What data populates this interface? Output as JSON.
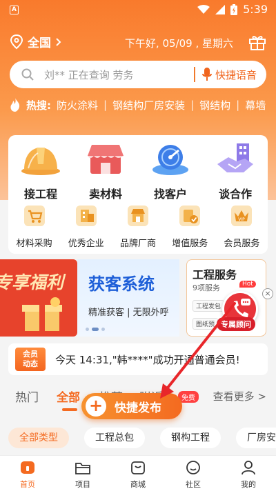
{
  "status": {
    "time": "5:39"
  },
  "header": {
    "location": "全国",
    "greeting": "下午好, 05/09 , 星期六"
  },
  "search": {
    "placeholder": "刘** 正在查询 劳务",
    "voice_label": "快捷语音"
  },
  "hot": {
    "label": "热搜:",
    "items": [
      "防火涂料",
      "钢结构厂房安装",
      "钢结构",
      "幕墙"
    ]
  },
  "main_actions": [
    {
      "label": "接工程",
      "icon": "hardhat-icon"
    },
    {
      "label": "卖材料",
      "icon": "store-icon"
    },
    {
      "label": "找客户",
      "icon": "radar-icon"
    },
    {
      "label": "谈合作",
      "icon": "handshake-icon"
    }
  ],
  "sub_actions": [
    {
      "label": "材料采购",
      "icon": "cart-icon"
    },
    {
      "label": "优秀企业",
      "icon": "enterprise-icon"
    },
    {
      "label": "品牌厂商",
      "icon": "shop-icon"
    },
    {
      "label": "增值服务",
      "icon": "service-icon"
    },
    {
      "label": "会员服务",
      "icon": "vip-icon"
    }
  ],
  "banners": {
    "b1_title": "专享福利",
    "b2_title": "获客系统",
    "b2_sub": "精准获客 | 无限外呼",
    "b3_title": "工程服务",
    "b3_sub": "9项服务",
    "b3_hot": "Hot",
    "b3_tag1": "工程发包",
    "b3_tag2": "图纸预"
  },
  "consult": {
    "label": "专属顾问"
  },
  "notice": {
    "tag_line1": "会员",
    "tag_line2": "动态",
    "text": "今天 14:31,\"韩****\"成功开通普通会员!"
  },
  "tabs": {
    "items": [
      "热门",
      "全部",
      "推荐",
      "附近"
    ],
    "more": "查看更多 >",
    "free": "免费"
  },
  "publish": {
    "label": "快捷发布"
  },
  "filters": [
    "全部类型",
    "工程总包",
    "钢构工程",
    "厂房安"
  ],
  "nav": [
    {
      "label": "首页",
      "icon": "home-icon"
    },
    {
      "label": "项目",
      "icon": "folder-icon"
    },
    {
      "label": "商城",
      "icon": "mall-icon"
    },
    {
      "label": "社区",
      "icon": "community-icon"
    },
    {
      "label": "我的",
      "icon": "profile-icon"
    }
  ],
  "colors": {
    "brand": "#f46a20",
    "accent_red": "#e8343a",
    "annotation_arrow": "#e8262a"
  }
}
